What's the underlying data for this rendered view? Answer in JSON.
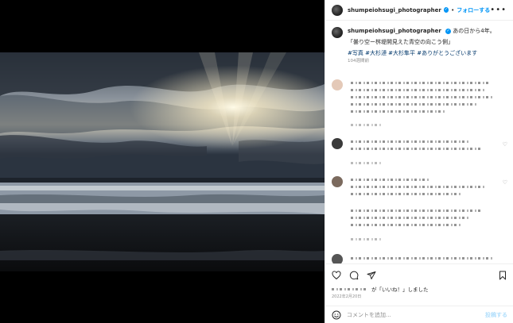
{
  "post": {
    "username": "shumpeiohsugi_photographer",
    "verified_mark": "✓",
    "separator": "•",
    "follow_label": "フォローする",
    "more_label": "•••"
  },
  "caption": {
    "line1": "あの日から4年。",
    "line2": "「曇り空ー桝堤開見えた青空の向こう側」",
    "tags": "#写真 #大杉漣 #大杉隼平 #ありがとうございます",
    "time_ago": "104週間前"
  },
  "likes": {
    "suffix": "が「いいね！」しました"
  },
  "date": "2022年2月20日",
  "comment_box": {
    "placeholder": "コメントを追加...",
    "post_label": "投稿する"
  },
  "icons": {
    "heart": "heart-icon",
    "comment": "comment-icon",
    "share": "share-icon",
    "bookmark": "bookmark-icon",
    "emoji": "emoji-icon"
  },
  "colors": {
    "link_blue": "#0095f6",
    "hashtag_blue": "#00376b",
    "muted_gray": "#8e8e8e"
  }
}
